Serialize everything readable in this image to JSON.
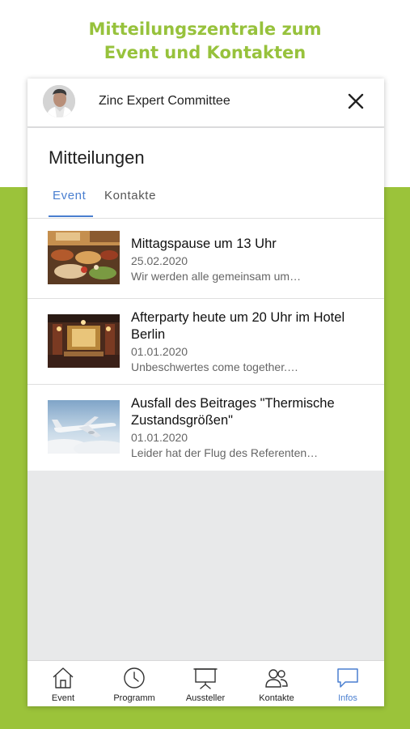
{
  "headline": {
    "line1": "Mitteilungszentrale zum",
    "line2": "Event und Kontakten"
  },
  "appbar": {
    "title": "Zinc Expert Committee",
    "avatar_icon": "person-avatar",
    "close_icon": "close-icon"
  },
  "section": {
    "title": "Mitteilungen"
  },
  "tabs": [
    {
      "label": "Event",
      "active": true
    },
    {
      "label": "Kontakte",
      "active": false
    }
  ],
  "messages": [
    {
      "title": "Mittagspause um 13 Uhr",
      "date": "25.02.2020",
      "snippet": "Wir werden alle gemeinsam um…",
      "image": "buffet-photo"
    },
    {
      "title": "Afterparty heute um 20 Uhr im Hotel Berlin",
      "date": "01.01.2020",
      "snippet": "Unbeschwertes come together.…",
      "image": "hotel-lobby-photo"
    },
    {
      "title": "Ausfall des Beitrages \"Thermische Zustandsgrößen\"",
      "date": "01.01.2020",
      "snippet": "Leider hat der Flug des Referenten…",
      "image": "airplane-photo"
    }
  ],
  "bottom_nav": [
    {
      "label": "Event",
      "icon": "home-icon",
      "active": false
    },
    {
      "label": "Programm",
      "icon": "clock-icon",
      "active": false
    },
    {
      "label": "Aussteller",
      "icon": "presentation-board-icon",
      "active": false
    },
    {
      "label": "Kontakte",
      "icon": "people-icon",
      "active": false
    },
    {
      "label": "Infos",
      "icon": "chat-bubble-icon",
      "active": true
    }
  ],
  "colors": {
    "brand_green": "#9bc33a",
    "accent_blue": "#4a7fd0"
  }
}
